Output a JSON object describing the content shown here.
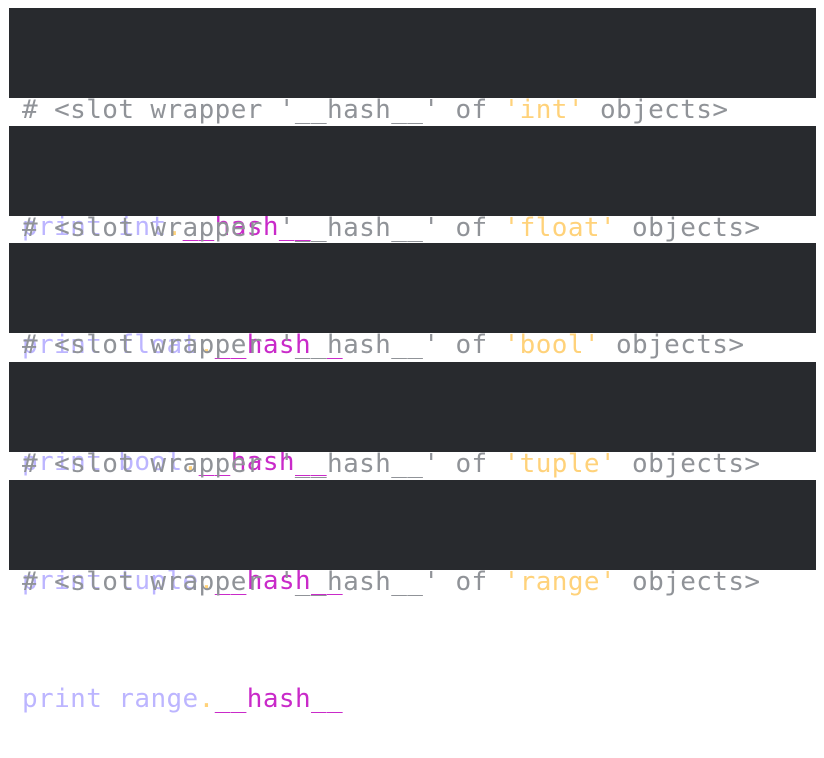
{
  "colors": {
    "background": "#282a2e",
    "comment": "#909398",
    "string": "#ffd27a",
    "builtin": "#bcb5ff",
    "dunder": "#c92ac9",
    "paren": "#ffffff"
  },
  "blocks": [
    {
      "comment_pre": "# <slot wrapper '__hash__' of ",
      "type_literal": "'int'",
      "comment_post": " objects>",
      "print_fn": "print",
      "open_paren": "(",
      "type_name": "int",
      "dot": ".",
      "attribute": "__hash__",
      "close_paren": ")"
    },
    {
      "comment_pre": "# <slot wrapper '__hash__' of ",
      "type_literal": "'float'",
      "comment_post": " objects>",
      "print_fn": "print",
      "open_paren": "(",
      "type_name": "float",
      "dot": ".",
      "attribute": "__hash__",
      "close_paren": ")"
    },
    {
      "comment_pre": "# <slot wrapper '__hash__' of ",
      "type_literal": "'bool'",
      "comment_post": " objects>",
      "print_fn": "print",
      "open_paren": "(",
      "type_name": "bool",
      "dot": ".",
      "attribute": "__hash__",
      "close_paren": ")"
    },
    {
      "comment_pre": "# <slot wrapper '__hash__' of ",
      "type_literal": "'tuple'",
      "comment_post": " objects>",
      "print_fn": "print",
      "open_paren": "(",
      "type_name": "tuple",
      "dot": ".",
      "attribute": "__hash__",
      "close_paren": ")"
    },
    {
      "comment_pre": "# <slot wrapper '__hash__' of ",
      "type_literal": "'range'",
      "comment_post": " objects>",
      "print_fn": "print",
      "open_paren": "(",
      "type_name": "range",
      "dot": ".",
      "attribute": "__hash__",
      "close_paren": ")"
    }
  ]
}
